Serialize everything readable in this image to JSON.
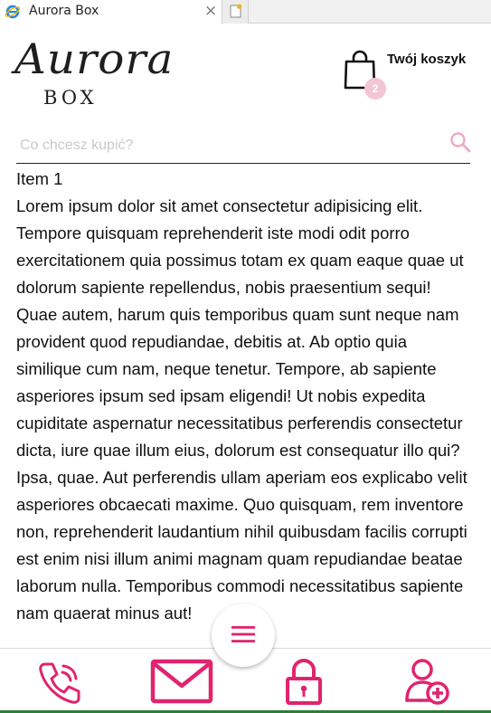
{
  "browser": {
    "tab_title": "Aurora Box",
    "close_glyph": "×"
  },
  "header": {
    "logo_script": "Aurora",
    "logo_word": "BOX",
    "cart": {
      "label": "Twój koszyk",
      "count": "2"
    }
  },
  "search": {
    "placeholder": "Co chcesz kupić?",
    "value": ""
  },
  "content": {
    "title": "Item 1",
    "text": "Lorem ipsum dolor sit amet consectetur adipisicing elit. Tempore quisquam reprehenderit iste modi odit porro exercitationem quia possimus totam ex quam eaque quae ut dolorum sapiente repellendus, nobis praesentium sequi! Quae autem, harum quis temporibus quam sunt neque nam provident quod repudiandae, debitis at. Ab optio quia similique cum nam, neque tenetur. Tempore, ab sapiente asperiores ipsum sed ipsam eligendi! Ut nobis expedita cupiditate aspernatur necessitatibus perferendis consectetur dicta, iure quae illum eius, dolorum est consequatur illo qui? Ipsa, quae. Aut perferendis ullam aperiam eos explicabo velit asperiores obcaecati maxime. Quo quisquam, rem inventore non, reprehenderit laudantium nihil quibusdam facilis corrupti est enim nisi illum animi magnam quam repudiandae beatae laborum nulla. Temporibus commodi necessitatibus sapiente nam quaerat minus aut!"
  },
  "bottom_bar": {
    "icons": [
      "phone-icon",
      "mail-icon",
      "lock-icon",
      "add-user-icon"
    ],
    "menu_icon": "hamburger-menu-icon"
  },
  "colors": {
    "accent": "#e0246e",
    "badge": "#f2c6d5",
    "search_icon": "#f0a8c2",
    "text": "#111111"
  }
}
